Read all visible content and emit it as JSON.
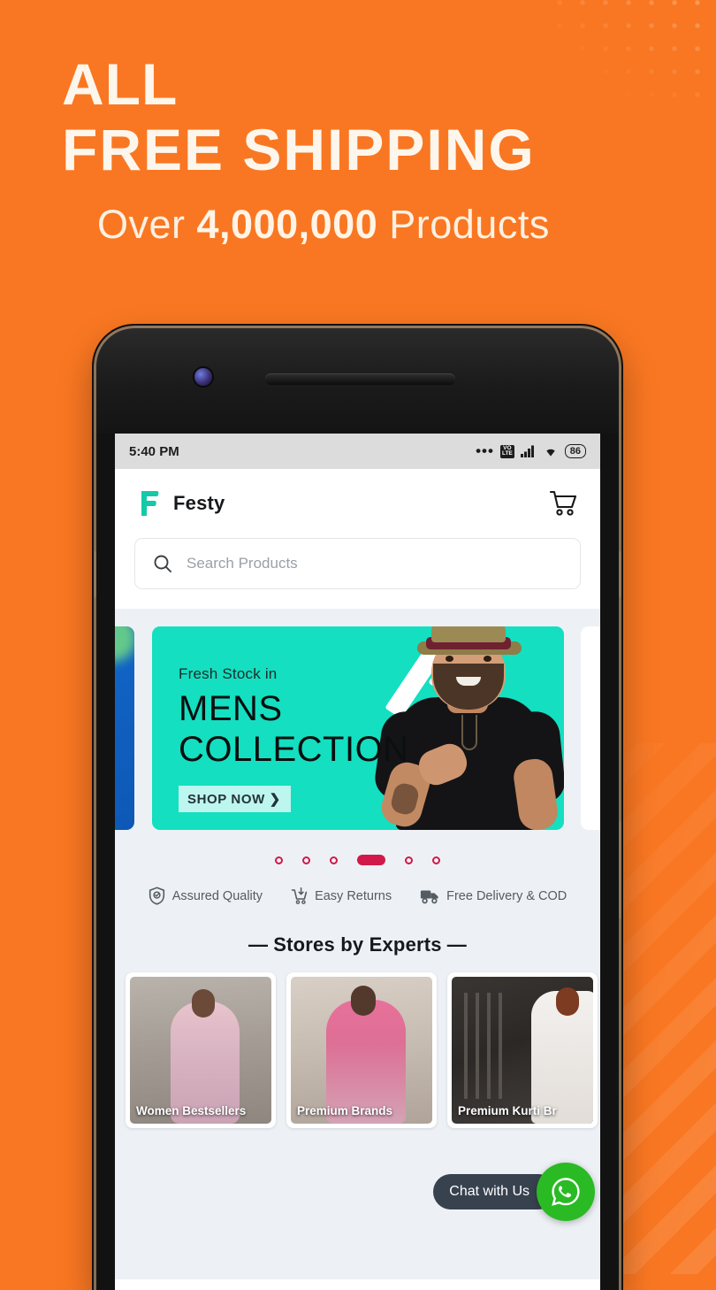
{
  "hero": {
    "line1": "ALL",
    "line2": "FREE SHIPPING",
    "sub_prefix": "Over ",
    "sub_number": "4,000,000",
    "sub_suffix": " Products"
  },
  "colors": {
    "background": "#F97722",
    "hero_text": "#FDF6EC",
    "brand_teal": "#14C9A8",
    "banner_teal": "#14DFC0",
    "dot_active": "#D2184A",
    "whatsapp_green": "#2ABA24",
    "chat_pill": "#38424F"
  },
  "phone": {
    "status_bar": {
      "time": "5:40 PM",
      "more_dots": "•••",
      "volte_line1": "VO",
      "volte_line2": "LTE",
      "signal_icon": "signal-bars-icon",
      "wifi_icon": "wifi-icon",
      "battery_level": "86"
    },
    "appbar": {
      "logo_icon": "festy-logo-icon",
      "brand_name": "Festy",
      "cart_icon": "shopping-cart-icon"
    },
    "search": {
      "icon": "search-icon",
      "placeholder": "Search Products",
      "value": ""
    },
    "carousel": {
      "banner": {
        "kicker": "Fresh Stock in",
        "line1": "MENS",
        "line2": "COLLECTION",
        "cta": "SHOP NOW",
        "cta_icon": "chevron-right-icon"
      },
      "dots_total": 6,
      "dots_active_index": 3
    },
    "features": [
      {
        "icon": "shield-check-icon",
        "label": "Assured Quality"
      },
      {
        "icon": "return-cart-icon",
        "label": "Easy Returns"
      },
      {
        "icon": "delivery-truck-icon",
        "label": "Free Delivery & COD"
      }
    ],
    "section": {
      "dash_left": "—",
      "title": "Stores by Experts",
      "dash_right": "—"
    },
    "stores": [
      {
        "label": "Women Bestsellers"
      },
      {
        "label": "Premium Brands"
      },
      {
        "label": "Premium Kurti Br"
      }
    ],
    "chat": {
      "label": "Chat with Us",
      "icon": "whatsapp-icon"
    }
  }
}
